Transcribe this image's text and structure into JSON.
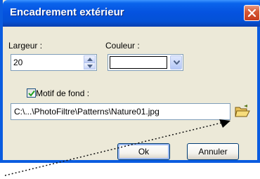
{
  "window": {
    "title": "Encadrement extérieur"
  },
  "width_field": {
    "label": "Largeur :",
    "value": "20"
  },
  "color_field": {
    "label": "Couleur :",
    "selected_color": "#ffffff"
  },
  "background_pattern": {
    "checkbox_label": "Motif de fond :",
    "checked": true,
    "path": "C:\\...\\PhotoFiltre\\Patterns\\Nature01.jpg"
  },
  "buttons": {
    "ok": "Ok",
    "cancel": "Annuler"
  },
  "colors": {
    "titlebar": "#0553e0",
    "dialog_bg": "#ece9d8",
    "close_button": "#d65a36",
    "check_mark": "#21a121",
    "folder": "#e8c25a"
  },
  "icons": [
    "close-icon",
    "spin-up-icon",
    "spin-down-icon",
    "dropdown-arrow-icon",
    "checkmark-icon",
    "folder-open-icon",
    "mouse-pointer-icon"
  ]
}
